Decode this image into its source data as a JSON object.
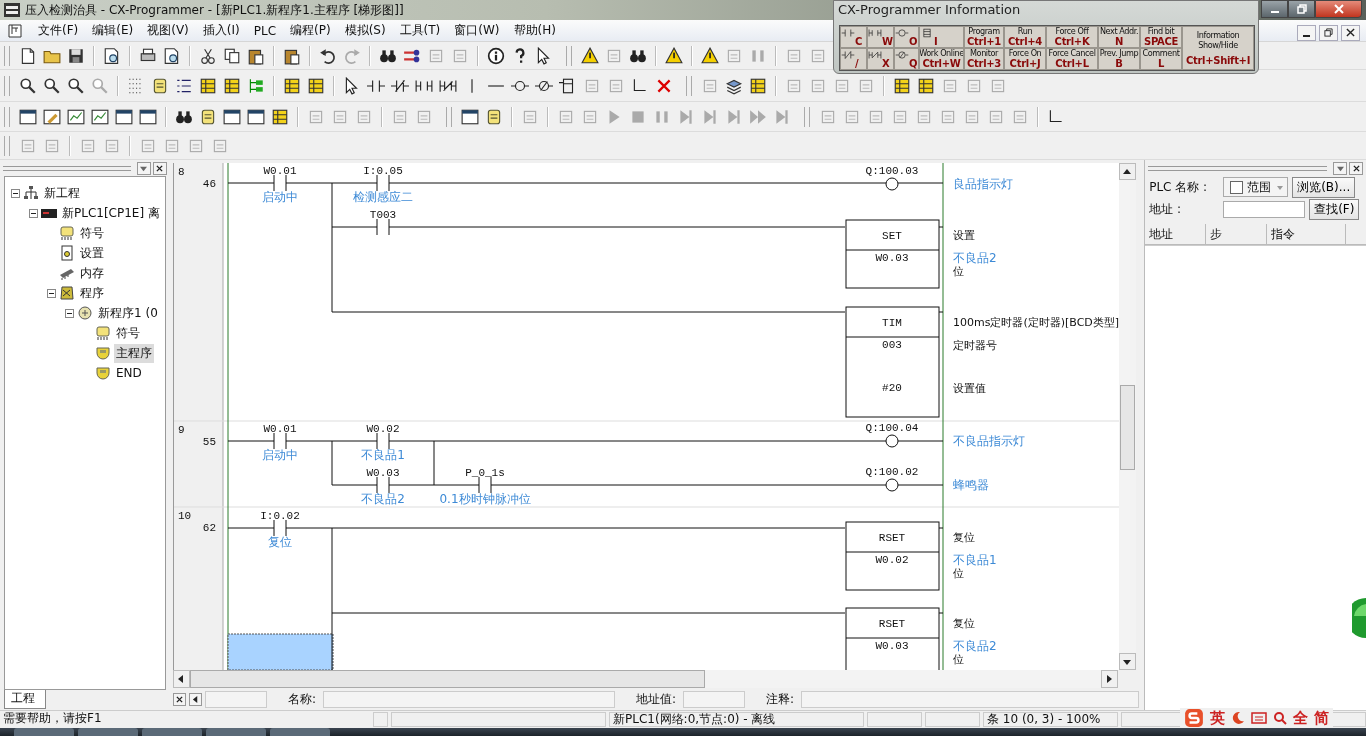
{
  "window": {
    "title": "压入检测治具 - CX-Programmer - [新PLC1.新程序1.主程序 [梯形图]]"
  },
  "menu": [
    "文件(F)",
    "编辑(E)",
    "视图(V)",
    "插入(I)",
    "PLC",
    "编程(P)",
    "模拟(S)",
    "工具(T)",
    "窗口(W)",
    "帮助(H)"
  ],
  "info_panel": {
    "title": "CX-Programmer Information",
    "top_row": [
      {
        "kind": "contact",
        "key": "C"
      },
      {
        "kind": "parallel",
        "key": "W"
      },
      {
        "kind": "coil",
        "key": "O"
      },
      {
        "kind": "block",
        "key": "I"
      },
      {
        "kind": "command",
        "label": "Program",
        "key": "Ctrl+1"
      },
      {
        "kind": "command",
        "label": "Run",
        "key": "Ctrl+4"
      },
      {
        "kind": "command",
        "label": "Force Off",
        "key": "Ctrl+K"
      },
      {
        "kind": "command",
        "label": "Next Addr.",
        "key": "N"
      },
      {
        "kind": "command",
        "label": "Find bit",
        "key": "SPACE"
      }
    ],
    "bottom_row": [
      {
        "kind": "closed",
        "key": "/"
      },
      {
        "kind": "closedparallel",
        "key": "X"
      },
      {
        "kind": "closedcoil",
        "key": "Q"
      },
      {
        "kind": "command",
        "label": "Work Online",
        "key": "Ctrl+W"
      },
      {
        "kind": "command",
        "label": "Monitor",
        "key": "Ctrl+3"
      },
      {
        "kind": "command",
        "label": "Force On",
        "key": "Ctrl+J"
      },
      {
        "kind": "command",
        "label": "Force Cancel",
        "key": "Ctrl+L"
      },
      {
        "kind": "command",
        "label": "Prev. Jump",
        "key": "B"
      },
      {
        "kind": "command",
        "label": "Comment",
        "key": "L"
      }
    ],
    "toggle": {
      "label": "Information Show/Hide",
      "key": "Ctrl+Shift+I"
    }
  },
  "project_tree": [
    {
      "kind": "project",
      "label": "新工程",
      "expanded": true,
      "selected": false,
      "children": [
        {
          "kind": "plc",
          "label": "新PLC1[CP1E] 离",
          "expanded": true,
          "selected": false,
          "children": [
            {
              "kind": "symbols",
              "label": "符号",
              "selected": false
            },
            {
              "kind": "settings",
              "label": "设置",
              "selected": false
            },
            {
              "kind": "memory",
              "label": "内存",
              "selected": false
            },
            {
              "kind": "programs",
              "label": "程序",
              "expanded": true,
              "selected": false,
              "children": [
                {
                  "kind": "program",
                  "label": "新程序1 (0",
                  "expanded": true,
                  "selected": false,
                  "children": [
                    {
                      "kind": "symbols",
                      "label": "符号",
                      "selected": false
                    },
                    {
                      "kind": "section",
                      "label": "主程序",
                      "selected": true
                    },
                    {
                      "kind": "section",
                      "label": "END",
                      "selected": false
                    }
                  ]
                }
              ]
            }
          ]
        }
      ]
    }
  ],
  "project_tab": "工程",
  "ladder": {
    "rungs": [
      {
        "number": "8",
        "step": "46",
        "contacts": [
          {
            "address": "W0.01",
            "comment": "启动中"
          },
          {
            "address": "I:0.05",
            "comment": "检测感应二"
          },
          {
            "address": "T003"
          }
        ],
        "outputs": [
          {
            "kind": "coil",
            "address": "Q:100.03",
            "comment": "良品指示灯"
          },
          {
            "kind": "instruction",
            "mnemonic": "SET",
            "description": "设置",
            "operands": [
              {
                "value": "W0.03",
                "comment": "不良品2",
                "label": "位"
              }
            ]
          },
          {
            "kind": "instruction",
            "mnemonic": "TIM",
            "description": "100ms定时器(定时器)[BCD类型]",
            "operands": [
              {
                "value": "003",
                "label": "定时器号"
              },
              {
                "value": "#20",
                "label": "设置值"
              }
            ]
          }
        ]
      },
      {
        "number": "9",
        "step": "55",
        "contacts": [
          {
            "address": "W0.01",
            "comment": "启动中"
          },
          {
            "address": "W0.02",
            "comment": "不良品1"
          },
          {
            "address": "W0.03",
            "comment": "不良品2"
          },
          {
            "address": "P_0_1s",
            "comment": "0.1秒时钟脉冲位"
          }
        ],
        "outputs": [
          {
            "kind": "coil",
            "address": "Q:100.04",
            "comment": "不良品指示灯"
          },
          {
            "kind": "coil",
            "address": "Q:100.02",
            "comment": "蜂鸣器"
          }
        ]
      },
      {
        "number": "10",
        "step": "62",
        "contacts": [
          {
            "address": "I:0.02",
            "comment": "复位"
          }
        ],
        "outputs": [
          {
            "kind": "instruction",
            "mnemonic": "RSET",
            "description": "复位",
            "operands": [
              {
                "value": "W0.02",
                "comment": "不良品1",
                "label": "位"
              }
            ]
          },
          {
            "kind": "instruction",
            "mnemonic": "RSET",
            "description": "复位",
            "operands": [
              {
                "value": "W0.03",
                "comment": "不良品2",
                "label": "位"
              }
            ]
          }
        ]
      }
    ]
  },
  "address_panel": {
    "plc_name_label": "PLC 名称 :",
    "range_checkbox": {
      "label": "范围",
      "checked": false
    },
    "browse_button": "浏览(B)...",
    "address_label": "地址 :",
    "find_button": "查找(F)",
    "columns": [
      "地址",
      "步",
      "指令"
    ]
  },
  "info_bar": {
    "name_label": "名称:",
    "address_label": "地址值:",
    "comment_label": "注释:"
  },
  "status_bar": {
    "help": "需要帮助，请按F1",
    "connection": "新PLC1(网络:0,节点:0) - 离线",
    "position": "条 10 (0, 3)  - 100%"
  },
  "ime_bar": [
    "英",
    "全",
    "简"
  ]
}
